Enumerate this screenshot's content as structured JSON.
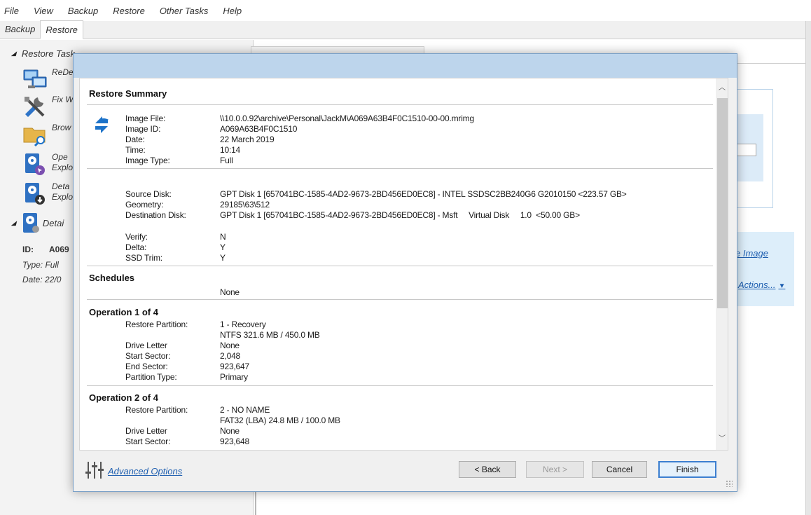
{
  "menu": [
    "File",
    "View",
    "Backup",
    "Restore",
    "Other Tasks",
    "Help"
  ],
  "main_tabs": [
    {
      "label": "Backup",
      "active": false
    },
    {
      "label": "Restore",
      "active": true
    }
  ],
  "left_panel": {
    "restore_tasks_heading": "Restore Task",
    "tasks": [
      {
        "label_line1": "ReDe",
        "label_line2": "",
        "icon": "redeploy-icon"
      },
      {
        "label_line1": "Fix W",
        "label_line2": "",
        "icon": "tools-icon"
      },
      {
        "label_line1": "Brow",
        "label_line2": "",
        "icon": "folder-search-icon"
      },
      {
        "label_line1": "Ope",
        "label_line2": "Explo",
        "icon": "disk-open-icon"
      },
      {
        "label_line1": "Deta",
        "label_line2": "Explo",
        "icon": "disk-detach-icon"
      }
    ],
    "details_heading": "Detai",
    "id_label": "ID:",
    "id_value": "A069",
    "type_text": "Type: Full",
    "date_text": "Date: 22/0"
  },
  "background_links": {
    "image_link": "e Image",
    "actions_link": "Actions..."
  },
  "dialog": {
    "restore_summary_title": "Restore Summary",
    "image_info": [
      {
        "label": "Image File:",
        "value": "\\\\10.0.0.92\\archive\\Personal\\JackM\\A069A63B4F0C1510-00-00.mrimg"
      },
      {
        "label": "Image ID:",
        "value": "A069A63B4F0C1510"
      },
      {
        "label": "Date:",
        "value": "22 March 2019"
      },
      {
        "label": "Time:",
        "value": "10:14"
      },
      {
        "label": "Image Type:",
        "value": "Full"
      }
    ],
    "disk_info": [
      {
        "label": "Source Disk:",
        "value": "GPT Disk 1 [657041BC-1585-4AD2-9673-2BD456ED0EC8] - INTEL SSDSC2BB240G6 G2010150  <223.57 GB>"
      },
      {
        "label": "Geometry:",
        "value": "29185\\63\\512"
      },
      {
        "label": "Destination Disk:",
        "value": "GPT Disk 1 [657041BC-1585-4AD2-9673-2BD456ED0EC8] - Msft     Virtual Disk     1.0  <50.00 GB>"
      }
    ],
    "options_info": [
      {
        "label": "Verify:",
        "value": "N"
      },
      {
        "label": "Delta:",
        "value": "Y"
      },
      {
        "label": "SSD Trim:",
        "value": "Y"
      }
    ],
    "schedules_title": "Schedules",
    "schedules_value": "None",
    "operation1": {
      "title": "Operation 1 of 4",
      "rows": [
        {
          "label": "Restore Partition:",
          "value": "1 - Recovery"
        },
        {
          "label": "",
          "value": "NTFS 321.6 MB / 450.0 MB"
        },
        {
          "label": "Drive Letter",
          "value": "None"
        },
        {
          "label": "Start Sector:",
          "value": "2,048"
        },
        {
          "label": "End Sector:",
          "value": "923,647"
        },
        {
          "label": "Partition Type:",
          "value": "Primary"
        }
      ]
    },
    "operation2": {
      "title": "Operation 2 of 4",
      "rows": [
        {
          "label": "Restore Partition:",
          "value": "2 - NO NAME"
        },
        {
          "label": "",
          "value": "FAT32 (LBA) 24.8 MB / 100.0 MB"
        },
        {
          "label": "Drive Letter",
          "value": "None"
        },
        {
          "label": "Start Sector:",
          "value": "923,648"
        }
      ]
    },
    "advanced_options": "Advanced Options",
    "buttons": {
      "back": "< Back",
      "next": "Next >",
      "cancel": "Cancel",
      "finish": "Finish"
    }
  },
  "colors": {
    "accent": "#1f5fb0",
    "title_bar": "#bdd5ec",
    "restore_icon": "#1d73c9"
  }
}
